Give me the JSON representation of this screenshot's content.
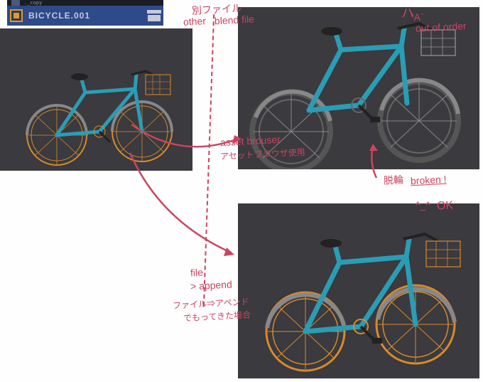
{
  "asset_bar": {
    "edge_text": "._copy",
    "label": "BICYCLE.001"
  },
  "annotations": {
    "other_file_jp": "別ファイル",
    "other_file_en1": "other",
    "other_file_en2": ".blend file",
    "out_of_order": "out of order",
    "asset_browser_en": "asset brouser",
    "asset_browser_jp": "アセットブラウザ使用",
    "broken_jp": "脱輪",
    "broken_en": "broken !",
    "ok": "OK",
    "file": "file",
    "append": "> append",
    "append_jp1": "ファイル⇒アペンド",
    "append_jp2": "でもってきた場合"
  },
  "emoji": {
    "shake": "ハ",
    "sad_face": "'A`",
    "happy_face": "^_^"
  }
}
